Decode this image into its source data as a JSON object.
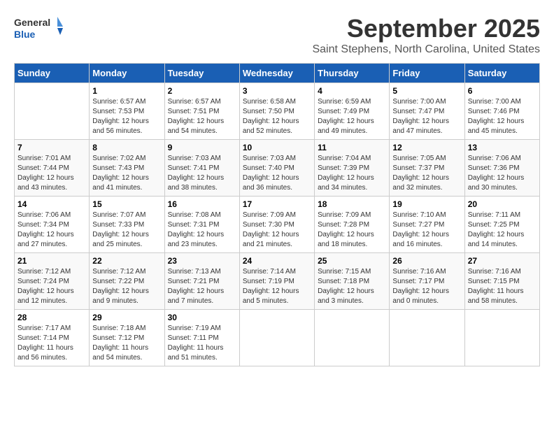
{
  "header": {
    "logo_general": "General",
    "logo_blue": "Blue",
    "title": "September 2025",
    "subtitle": "Saint Stephens, North Carolina, United States"
  },
  "weekdays": [
    "Sunday",
    "Monday",
    "Tuesday",
    "Wednesday",
    "Thursday",
    "Friday",
    "Saturday"
  ],
  "weeks": [
    [
      {
        "day": "",
        "info": ""
      },
      {
        "day": "1",
        "info": "Sunrise: 6:57 AM\nSunset: 7:53 PM\nDaylight: 12 hours\nand 56 minutes."
      },
      {
        "day": "2",
        "info": "Sunrise: 6:57 AM\nSunset: 7:51 PM\nDaylight: 12 hours\nand 54 minutes."
      },
      {
        "day": "3",
        "info": "Sunrise: 6:58 AM\nSunset: 7:50 PM\nDaylight: 12 hours\nand 52 minutes."
      },
      {
        "day": "4",
        "info": "Sunrise: 6:59 AM\nSunset: 7:49 PM\nDaylight: 12 hours\nand 49 minutes."
      },
      {
        "day": "5",
        "info": "Sunrise: 7:00 AM\nSunset: 7:47 PM\nDaylight: 12 hours\nand 47 minutes."
      },
      {
        "day": "6",
        "info": "Sunrise: 7:00 AM\nSunset: 7:46 PM\nDaylight: 12 hours\nand 45 minutes."
      }
    ],
    [
      {
        "day": "7",
        "info": "Sunrise: 7:01 AM\nSunset: 7:44 PM\nDaylight: 12 hours\nand 43 minutes."
      },
      {
        "day": "8",
        "info": "Sunrise: 7:02 AM\nSunset: 7:43 PM\nDaylight: 12 hours\nand 41 minutes."
      },
      {
        "day": "9",
        "info": "Sunrise: 7:03 AM\nSunset: 7:41 PM\nDaylight: 12 hours\nand 38 minutes."
      },
      {
        "day": "10",
        "info": "Sunrise: 7:03 AM\nSunset: 7:40 PM\nDaylight: 12 hours\nand 36 minutes."
      },
      {
        "day": "11",
        "info": "Sunrise: 7:04 AM\nSunset: 7:39 PM\nDaylight: 12 hours\nand 34 minutes."
      },
      {
        "day": "12",
        "info": "Sunrise: 7:05 AM\nSunset: 7:37 PM\nDaylight: 12 hours\nand 32 minutes."
      },
      {
        "day": "13",
        "info": "Sunrise: 7:06 AM\nSunset: 7:36 PM\nDaylight: 12 hours\nand 30 minutes."
      }
    ],
    [
      {
        "day": "14",
        "info": "Sunrise: 7:06 AM\nSunset: 7:34 PM\nDaylight: 12 hours\nand 27 minutes."
      },
      {
        "day": "15",
        "info": "Sunrise: 7:07 AM\nSunset: 7:33 PM\nDaylight: 12 hours\nand 25 minutes."
      },
      {
        "day": "16",
        "info": "Sunrise: 7:08 AM\nSunset: 7:31 PM\nDaylight: 12 hours\nand 23 minutes."
      },
      {
        "day": "17",
        "info": "Sunrise: 7:09 AM\nSunset: 7:30 PM\nDaylight: 12 hours\nand 21 minutes."
      },
      {
        "day": "18",
        "info": "Sunrise: 7:09 AM\nSunset: 7:28 PM\nDaylight: 12 hours\nand 18 minutes."
      },
      {
        "day": "19",
        "info": "Sunrise: 7:10 AM\nSunset: 7:27 PM\nDaylight: 12 hours\nand 16 minutes."
      },
      {
        "day": "20",
        "info": "Sunrise: 7:11 AM\nSunset: 7:25 PM\nDaylight: 12 hours\nand 14 minutes."
      }
    ],
    [
      {
        "day": "21",
        "info": "Sunrise: 7:12 AM\nSunset: 7:24 PM\nDaylight: 12 hours\nand 12 minutes."
      },
      {
        "day": "22",
        "info": "Sunrise: 7:12 AM\nSunset: 7:22 PM\nDaylight: 12 hours\nand 9 minutes."
      },
      {
        "day": "23",
        "info": "Sunrise: 7:13 AM\nSunset: 7:21 PM\nDaylight: 12 hours\nand 7 minutes."
      },
      {
        "day": "24",
        "info": "Sunrise: 7:14 AM\nSunset: 7:19 PM\nDaylight: 12 hours\nand 5 minutes."
      },
      {
        "day": "25",
        "info": "Sunrise: 7:15 AM\nSunset: 7:18 PM\nDaylight: 12 hours\nand 3 minutes."
      },
      {
        "day": "26",
        "info": "Sunrise: 7:16 AM\nSunset: 7:17 PM\nDaylight: 12 hours\nand 0 minutes."
      },
      {
        "day": "27",
        "info": "Sunrise: 7:16 AM\nSunset: 7:15 PM\nDaylight: 11 hours\nand 58 minutes."
      }
    ],
    [
      {
        "day": "28",
        "info": "Sunrise: 7:17 AM\nSunset: 7:14 PM\nDaylight: 11 hours\nand 56 minutes."
      },
      {
        "day": "29",
        "info": "Sunrise: 7:18 AM\nSunset: 7:12 PM\nDaylight: 11 hours\nand 54 minutes."
      },
      {
        "day": "30",
        "info": "Sunrise: 7:19 AM\nSunset: 7:11 PM\nDaylight: 11 hours\nand 51 minutes."
      },
      {
        "day": "",
        "info": ""
      },
      {
        "day": "",
        "info": ""
      },
      {
        "day": "",
        "info": ""
      },
      {
        "day": "",
        "info": ""
      }
    ]
  ]
}
